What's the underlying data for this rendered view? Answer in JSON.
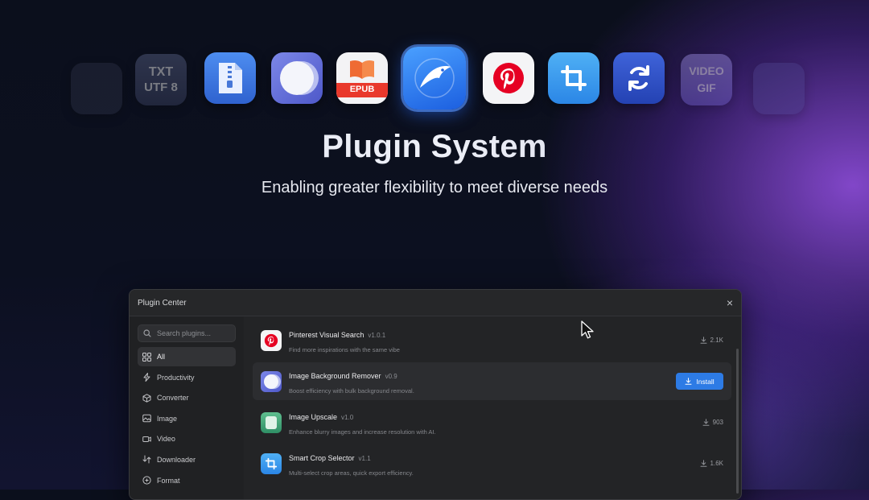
{
  "hero": {
    "icons": [
      {
        "name": "blank-plugin-icon",
        "label": ""
      },
      {
        "name": "txt-utf8-icon",
        "label_top": "TXT",
        "label_bottom": "UTF 8"
      },
      {
        "name": "zip-archive-icon",
        "label": ""
      },
      {
        "name": "background-remover-icon",
        "label": ""
      },
      {
        "name": "epub-book-icon",
        "label": "EPUB"
      },
      {
        "name": "eagle-app-icon",
        "label": ""
      },
      {
        "name": "pinterest-icon",
        "label": ""
      },
      {
        "name": "crop-icon",
        "label": ""
      },
      {
        "name": "sync-icon",
        "label": ""
      },
      {
        "name": "video-gif-icon",
        "label_top": "VIDEO",
        "label_bottom": "GIF"
      },
      {
        "name": "blank-plugin-icon",
        "label": ""
      }
    ],
    "title": "Plugin System",
    "subtitle": "Enabling greater flexibility to meet diverse needs"
  },
  "window": {
    "title": "Plugin Center",
    "close_label": "×",
    "search": {
      "placeholder": "Search plugins...",
      "value": ""
    },
    "sidebar": {
      "items": [
        {
          "label": "All",
          "icon": "grid-icon",
          "active": true
        },
        {
          "label": "Productivity",
          "icon": "lightning-icon",
          "active": false
        },
        {
          "label": "Converter",
          "icon": "cube-icon",
          "active": false
        },
        {
          "label": "Image",
          "icon": "image-icon",
          "active": false
        },
        {
          "label": "Video",
          "icon": "video-icon",
          "active": false
        },
        {
          "label": "Downloader",
          "icon": "download-icon",
          "active": false
        },
        {
          "label": "Format",
          "icon": "format-icon",
          "active": false
        }
      ]
    },
    "plugins": [
      {
        "name": "Pinterest Visual Search",
        "version": "v1.0.1",
        "description": "Find more inspirations with the same vibe",
        "downloads": "2.1K",
        "installed": true
      },
      {
        "name": "Image Background Remover",
        "version": "v0.9",
        "description": "Boost efficiency with bulk background removal.",
        "install_label": "Install",
        "installed": false
      },
      {
        "name": "Image Upscale",
        "version": "v1.0",
        "description": "Enhance blurry images and increase resolution with AI.",
        "downloads": "903",
        "installed": true
      },
      {
        "name": "Smart Crop Selector",
        "version": "v1.1",
        "description": "Multi-select crop areas, quick export efficiency.",
        "downloads": "1.6K",
        "installed": true
      }
    ]
  },
  "colors": {
    "accent": "#2d7be5",
    "pinterest": "#e60023",
    "window_bg": "#232426"
  }
}
